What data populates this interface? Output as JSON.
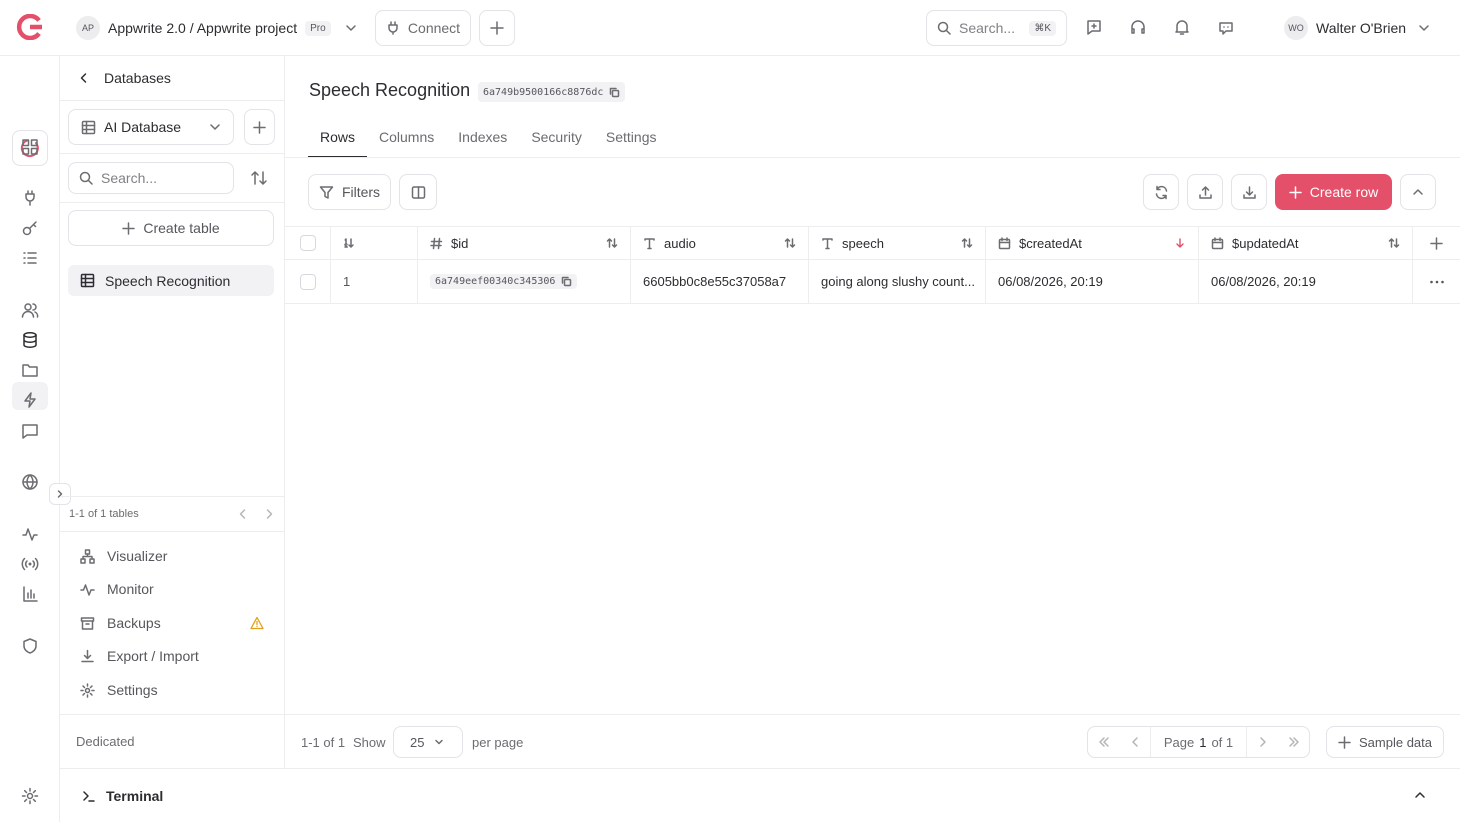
{
  "topbar": {
    "project_initials": "AP",
    "project_title": "Appwrite 2.0 / Appwrite project",
    "plan_badge": "Pro",
    "connect_label": "Connect",
    "search_placeholder": "Search...",
    "search_shortcut": "⌘K",
    "user_initials": "WO",
    "user_name": "Walter O'Brien"
  },
  "sidebar": {
    "back_label": "Databases",
    "database_name": "AI Database",
    "search_placeholder": "Search...",
    "create_table_label": "Create table",
    "tables": [
      {
        "name": "Speech Recognition"
      }
    ],
    "pagination_text": "1-1 of 1 tables",
    "links": [
      {
        "label": "Visualizer"
      },
      {
        "label": "Monitor"
      },
      {
        "label": "Backups"
      },
      {
        "label": "Export / Import"
      },
      {
        "label": "Settings"
      }
    ],
    "footer_label": "Dedicated"
  },
  "main": {
    "title": "Speech Recognition",
    "table_id": "6a749b9500166c8876dc",
    "tabs": [
      {
        "label": "Rows",
        "active": true
      },
      {
        "label": "Columns"
      },
      {
        "label": "Indexes"
      },
      {
        "label": "Security"
      },
      {
        "label": "Settings"
      }
    ],
    "filters_label": "Filters",
    "create_row_label": "Create row",
    "accent_color": "#e4506a",
    "columns": [
      {
        "name": "$id",
        "icon": "hash-icon"
      },
      {
        "name": "audio",
        "icon": "text-type-icon"
      },
      {
        "name": "speech",
        "icon": "text-type-icon"
      },
      {
        "name": "$createdAt",
        "icon": "calendar-icon",
        "sort": "descending"
      },
      {
        "name": "$updatedAt",
        "icon": "calendar-icon"
      }
    ],
    "rows": [
      {
        "index": "1",
        "id": "6a749eef00340c345306",
        "audio": "6605bb0c8e55c37058a7",
        "speech": "going along slushy count...",
        "createdAt": "06/08/2026, 20:19",
        "updatedAt": "06/08/2026, 20:19"
      }
    ],
    "footer": {
      "range_text": "1-1 of 1",
      "show_label": "Show",
      "per_page_value": "25",
      "per_page_label": "per page",
      "page_label": "Page",
      "page_current": "1",
      "page_total_label": "of 1",
      "sample_data_label": "Sample data"
    }
  },
  "terminal": {
    "label": "Terminal"
  }
}
